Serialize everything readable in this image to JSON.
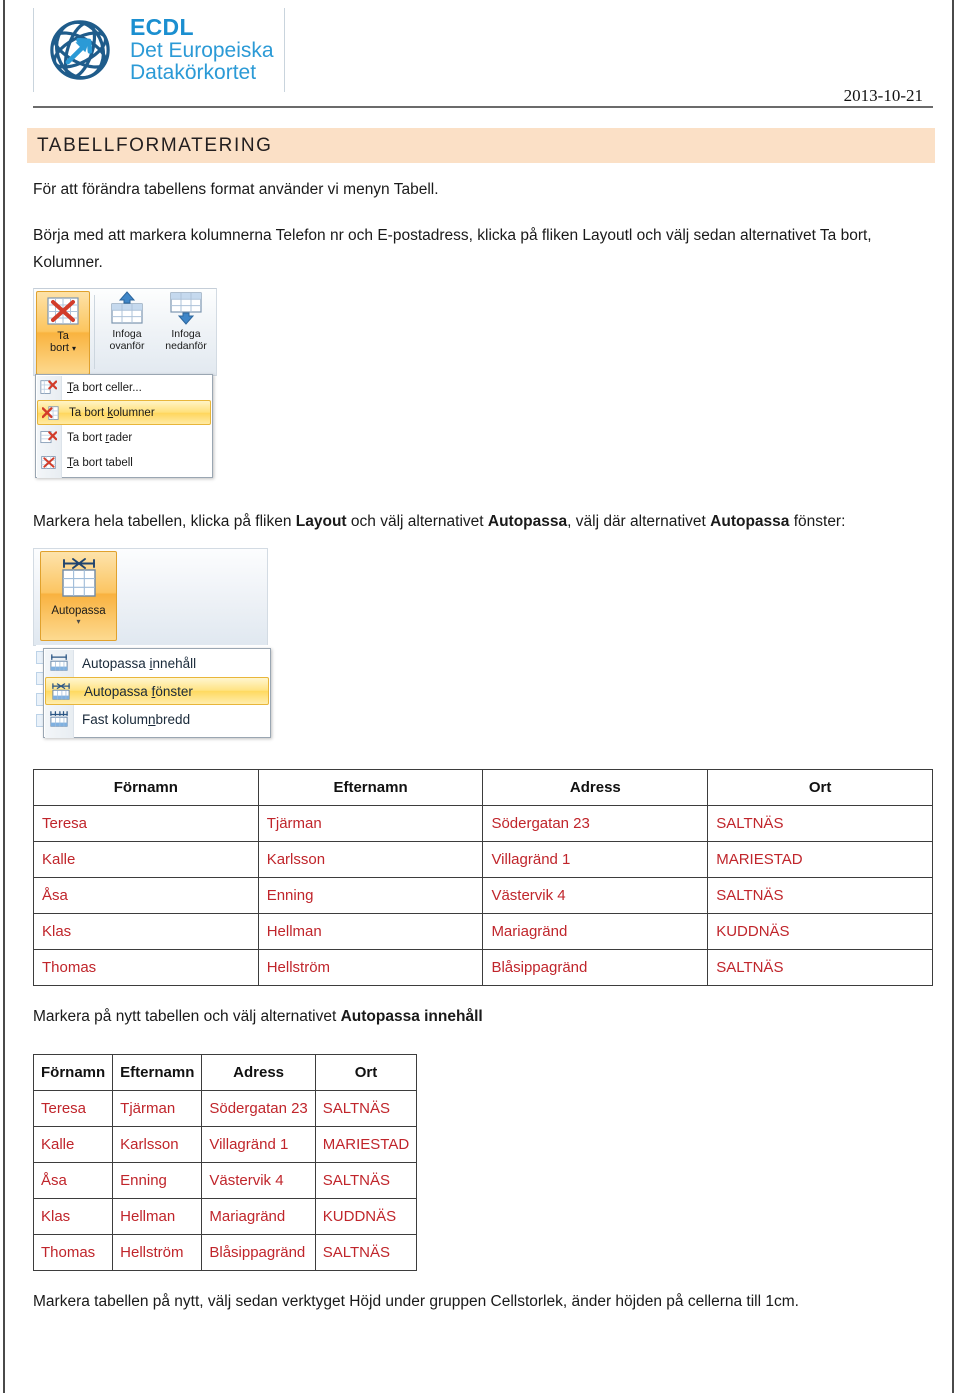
{
  "header": {
    "logo": {
      "line1": "ECDL",
      "line2": "Det Europeiska",
      "line3": "Datakörkortet"
    },
    "date": "2013-10-21"
  },
  "title_banner": {
    "text": "TABELLFORMATERING",
    "background": "#FBE0C6"
  },
  "paragraphs": {
    "p1": "För att förändra tabellens format använder vi menyn Tabell.",
    "p2_part1": "Börja med att markera kolumnerna Telefon nr och E-postadress, klicka på fliken Layoutl och välj sedan alternativet Ta bort,",
    "p2_part2": "Kolumner.",
    "p3_a": "Markera hela tabellen, klicka på fliken ",
    "p3_b": "Layout",
    "p3_c": " och välj alternativet ",
    "p3_d": "Autopassa",
    "p3_e": ", välj där alternativet ",
    "p3_f": "Autopassa",
    "p3_g": " fönster:",
    "p4_a": "Markera på nytt tabellen och välj alternativet ",
    "p4_b": "Autopassa innehåll",
    "p5": "Markera tabellen på nytt, välj sedan verktyget Höjd under gruppen Cellstorlek, änder höjden på cellerna till 1cm."
  },
  "ribbon_delete": {
    "button_label_line1": "Ta",
    "button_label_line2": "bort",
    "insert_above_line1": "Infoga",
    "insert_above_line2": "ovanför",
    "insert_below_line1": "Infoga",
    "insert_below_line2": "nedanför",
    "menu_items": [
      {
        "label": "Ta bort celler...",
        "mnemonic": "T",
        "rest": "a bort celler...",
        "selected": false
      },
      {
        "label": "Ta bort kolumner",
        "selected": true
      },
      {
        "label": "Ta bort rader",
        "selected": false
      },
      {
        "label": "Ta bort tabell",
        "selected": false
      }
    ]
  },
  "ribbon_autofit": {
    "button_label": "Autopassa",
    "caret": "▾",
    "menu_items": [
      {
        "label": "Autopassa innehåll",
        "selected": false
      },
      {
        "label": "Autopassa fönster",
        "selected": true
      },
      {
        "label": "Fast kolumnbredd",
        "selected": false
      }
    ]
  },
  "table_wide": {
    "headers": [
      "Förnamn",
      "Efternamn",
      "Adress",
      "Ort"
    ],
    "rows": [
      [
        "Teresa",
        "Tjärman",
        "Södergatan 23",
        "SALTNÄS"
      ],
      [
        "Kalle",
        "Karlsson",
        "Villagränd 1",
        "MARIESTAD"
      ],
      [
        "Åsa",
        "Enning",
        "Västervik 4",
        "SALTNÄS"
      ],
      [
        "Klas",
        "Hellman",
        "Mariagränd",
        "KUDDNÄS"
      ],
      [
        "Thomas",
        "Hellström",
        "Blåsippagränd",
        "SALTNÄS"
      ]
    ]
  },
  "table_narrow": {
    "headers": [
      "Förnamn",
      "Efternamn",
      "Adress",
      "Ort"
    ],
    "rows": [
      [
        "Teresa",
        "Tjärman",
        "Södergatan 23",
        "SALTNÄS"
      ],
      [
        "Kalle",
        "Karlsson",
        "Villagränd 1",
        "MARIESTAD"
      ],
      [
        "Åsa",
        "Enning",
        "Västervik 4",
        "SALTNÄS"
      ],
      [
        "Klas",
        "Hellman",
        "Mariagränd",
        "KUDDNÄS"
      ],
      [
        "Thomas",
        "Hellström",
        "Blåsippagränd",
        "SALTNÄS"
      ]
    ]
  },
  "colors": {
    "table_text": "#C0252B",
    "banner": "#FBE0C6",
    "logo_dark": "#1F5C8B",
    "logo_light": "#2B9AD6"
  }
}
